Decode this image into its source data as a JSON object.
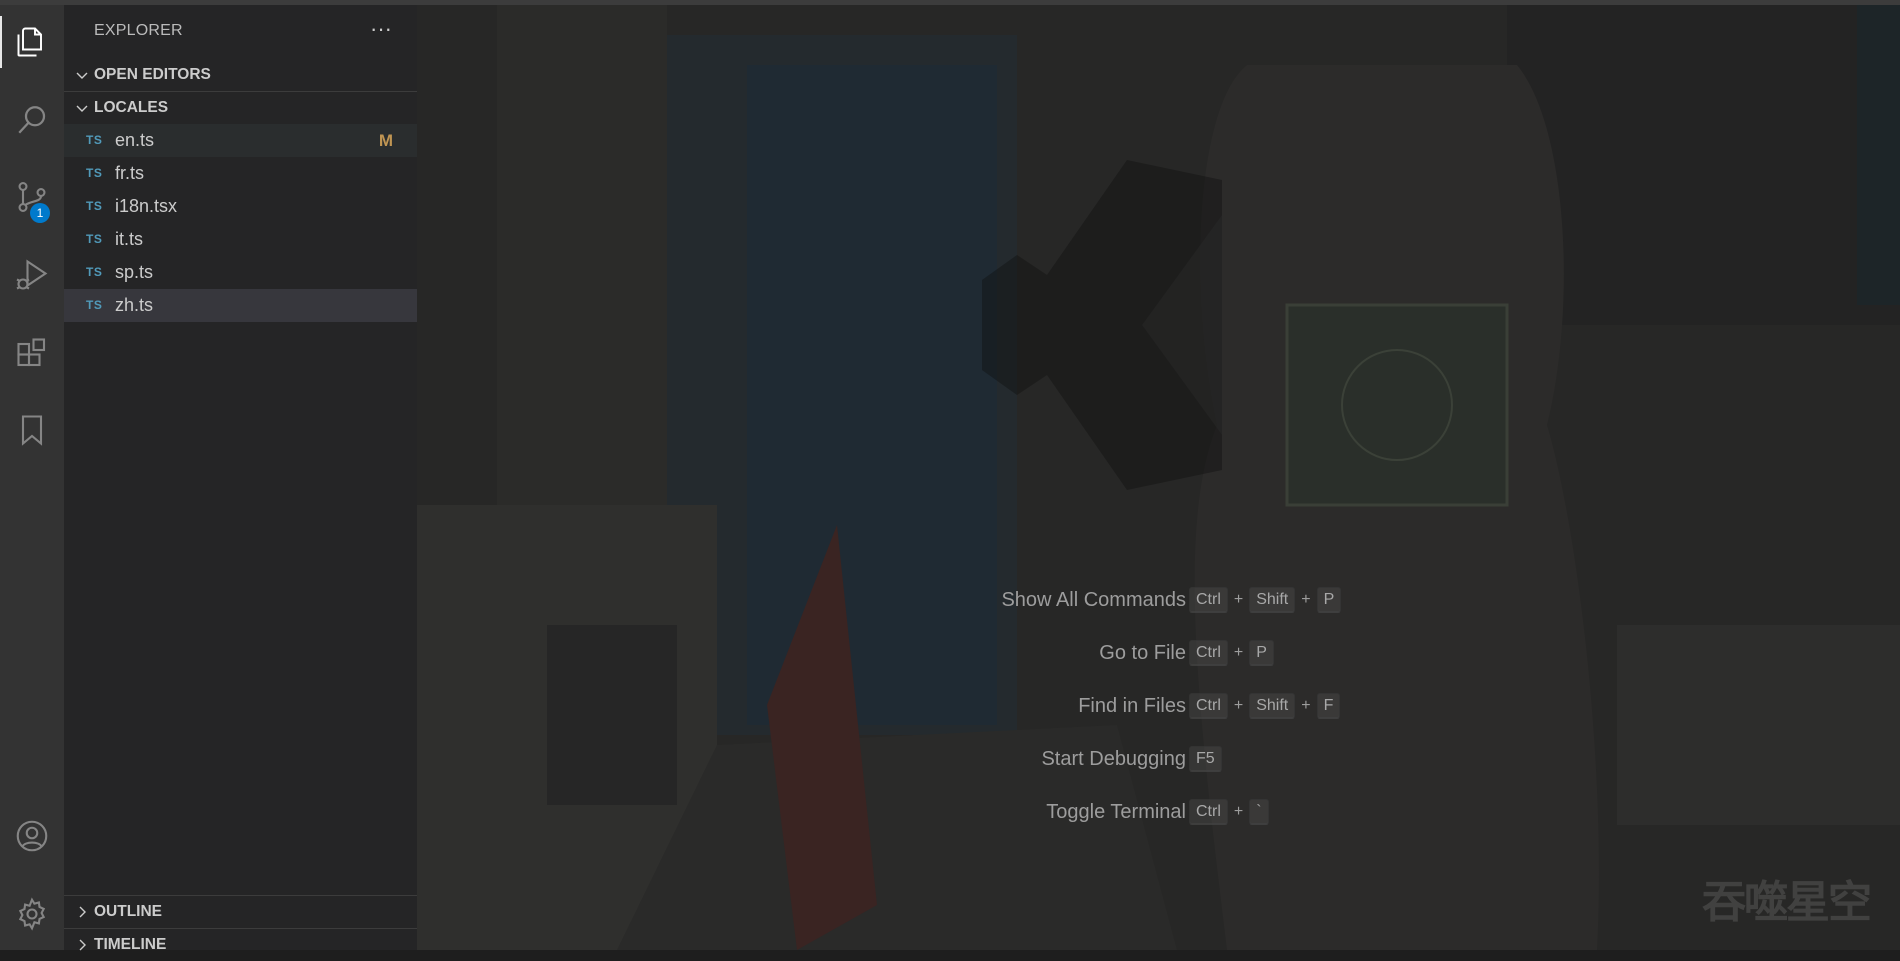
{
  "activity_bar": {
    "items": [
      {
        "name": "explorer-icon"
      },
      {
        "name": "search-icon"
      },
      {
        "name": "source-control-icon",
        "badge": "1"
      },
      {
        "name": "run-debug-icon"
      },
      {
        "name": "extensions-icon"
      },
      {
        "name": "bookmark-icon"
      }
    ],
    "bottom": [
      {
        "name": "account-icon"
      },
      {
        "name": "settings-gear-icon"
      }
    ],
    "source_control_badge": "1"
  },
  "sidebar": {
    "title": "EXPLORER",
    "more_label": "···",
    "open_editors": "OPEN EDITORS",
    "folder": "LOCALES",
    "files": [
      {
        "lang": "TS",
        "name": "en.ts",
        "status": "M"
      },
      {
        "lang": "TS",
        "name": "fr.ts",
        "status": ""
      },
      {
        "lang": "TS",
        "name": "i18n.tsx",
        "status": ""
      },
      {
        "lang": "TS",
        "name": "it.ts",
        "status": ""
      },
      {
        "lang": "TS",
        "name": "sp.ts",
        "status": ""
      },
      {
        "lang": "TS",
        "name": "zh.ts",
        "status": ""
      }
    ],
    "outline": "OUTLINE",
    "timeline": "TIMELINE"
  },
  "editor": {
    "shortcuts": [
      {
        "label": "Show All Commands",
        "keys": [
          "Ctrl",
          "Shift",
          "P"
        ]
      },
      {
        "label": "Go to File",
        "keys": [
          "Ctrl",
          "P"
        ]
      },
      {
        "label": "Find in Files",
        "keys": [
          "Ctrl",
          "Shift",
          "F"
        ]
      },
      {
        "label": "Start Debugging",
        "keys": [
          "F5"
        ]
      },
      {
        "label": "Toggle Terminal",
        "keys": [
          "Ctrl",
          "`"
        ]
      }
    ],
    "corner_watermark": "吞噬星空"
  },
  "colors": {
    "activity_bg": "#333333",
    "sidebar_bg": "#252526",
    "ts_icon": "#519aba",
    "modified": "#c09553",
    "badge": "#007acc"
  }
}
